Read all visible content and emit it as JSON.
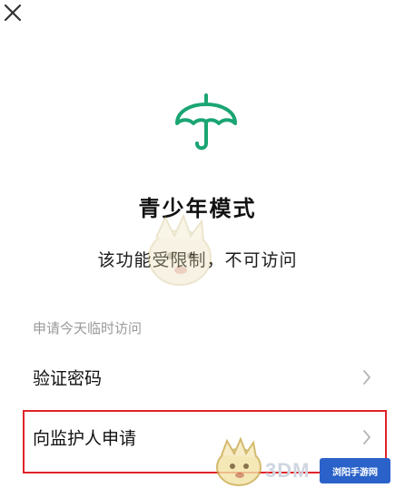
{
  "colors": {
    "accent": "#1aa573",
    "highlight": "#e0232a",
    "section_label": "#9a9a9a"
  },
  "header": {
    "close_icon": "close-icon"
  },
  "hero": {
    "icon": "umbrella-icon",
    "title": "青少年模式",
    "subtitle": "该功能受限制，不可访问"
  },
  "section": {
    "label": "申请今天临时访问",
    "items": [
      {
        "label": "验证密码",
        "icon": "chevron-right-icon"
      },
      {
        "label": "向监护人申请",
        "icon": "chevron-right-icon"
      }
    ]
  },
  "watermark": {
    "text": "3DM",
    "badge": "浏阳手游网"
  }
}
